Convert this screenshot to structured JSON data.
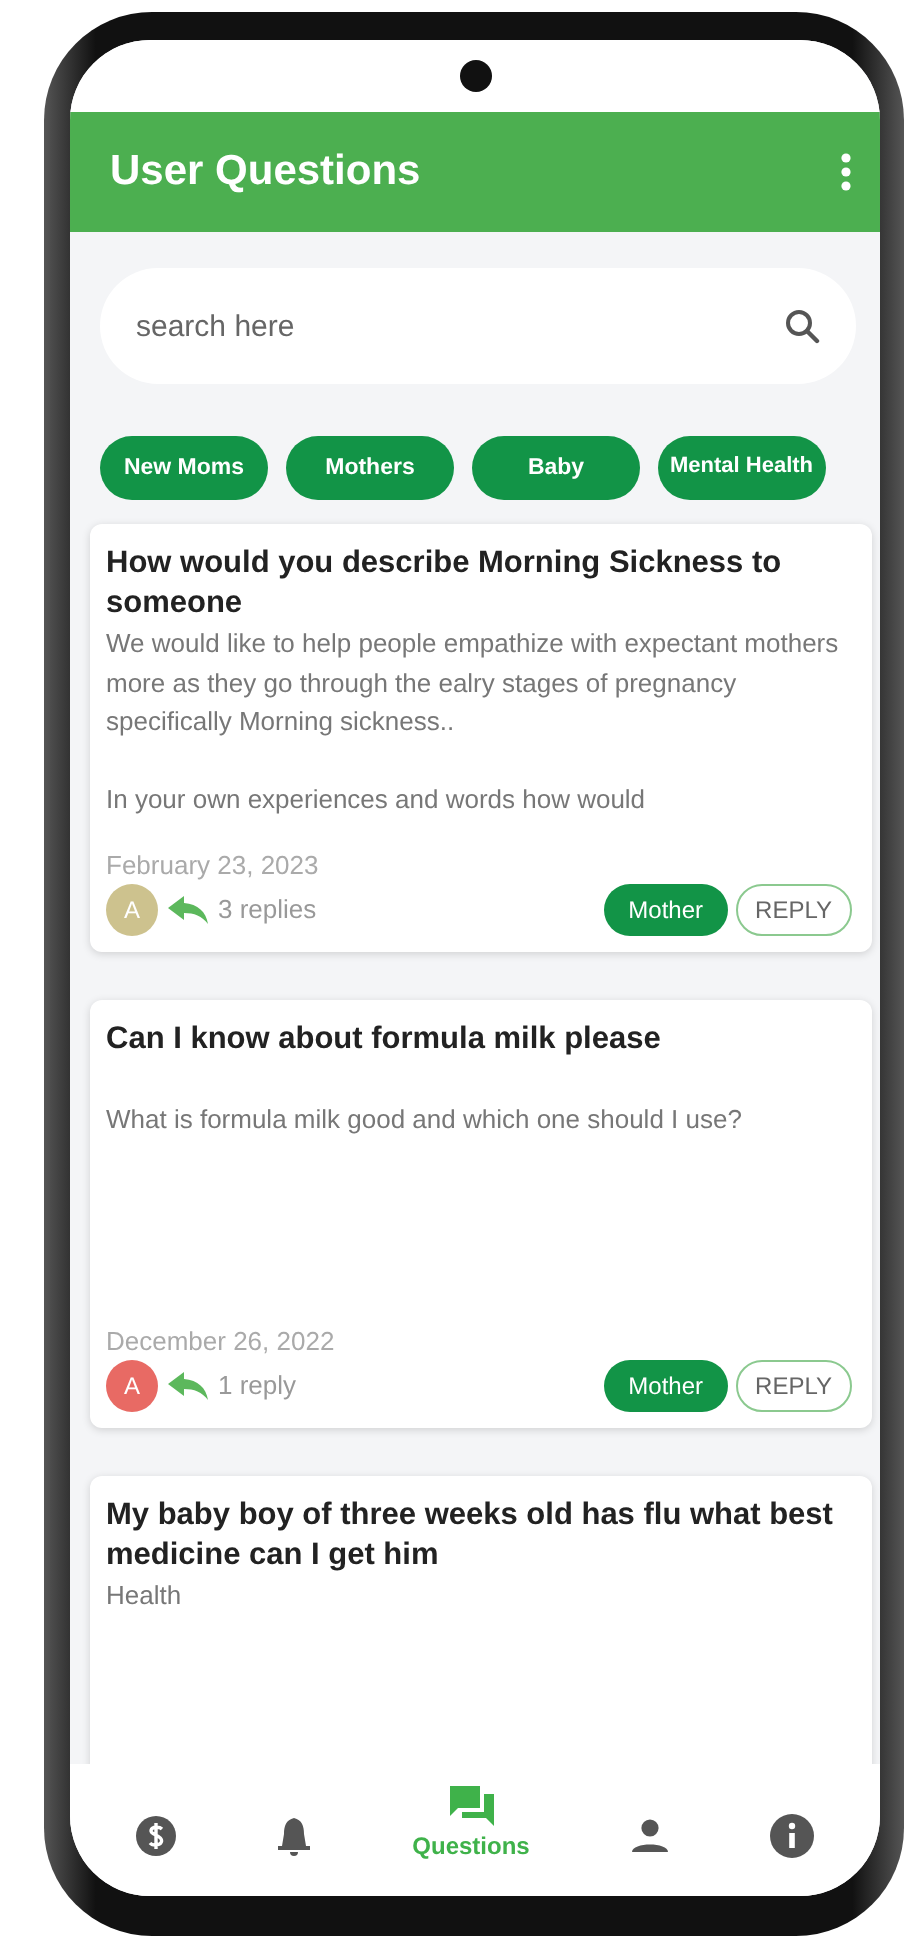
{
  "app_bar": {
    "title": "User Questions"
  },
  "search": {
    "placeholder": "search here"
  },
  "categories": [
    {
      "label": "New Moms"
    },
    {
      "label": "Mothers"
    },
    {
      "label": "Baby"
    },
    {
      "label": "Mental Health"
    }
  ],
  "questions": [
    {
      "title": "How would you describe Morning Sickness to someone",
      "body": [
        "We would like to help people empathize with expectant mothers more as they go through the ealry stages of pregnancy specifically Morning sickness..",
        "In your own experiences and words how would"
      ],
      "date": "February 23, 2023",
      "avatar": "A",
      "color": "#cdc28e",
      "replies": "3 replies",
      "tag": "Mother",
      "reply_button": "REPLY"
    },
    {
      "title": "Can I know about formula milk please",
      "body": [
        "What is formula milk good and which one should I use?"
      ],
      "date": "December 26, 2022",
      "avatar": "A",
      "color": "#e86a64",
      "replies": "1 reply",
      "tag": "Mother",
      "reply_button": "REPLY"
    },
    {
      "title": "My baby boy of three weeks old has flu what best medicine can I get him",
      "body": [
        "Health"
      ]
    }
  ],
  "bottom_nav": [
    {
      "kind": "dollar",
      "selected": false
    },
    {
      "kind": "bell",
      "selected": false
    },
    {
      "kind": "chat",
      "label": "Questions",
      "selected": true
    },
    {
      "kind": "person",
      "selected": false
    },
    {
      "kind": "info",
      "selected": false
    }
  ]
}
